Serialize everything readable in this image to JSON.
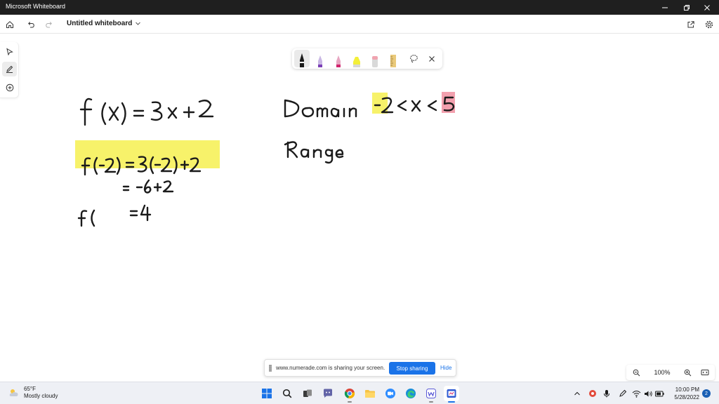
{
  "window": {
    "title": "Microsoft Whiteboard"
  },
  "toolbar": {
    "doc_title": "Untitled whiteboard"
  },
  "rail": {
    "items": [
      "select-tool",
      "pen-tool",
      "add-tool"
    ],
    "active": "pen-tool"
  },
  "palette": {
    "tools": [
      {
        "name": "black-pen",
        "color": "#1b1b1b"
      },
      {
        "name": "purple-pen",
        "color": "#7b3fb5"
      },
      {
        "name": "pink-pen",
        "color": "#d0246d"
      },
      {
        "name": "yellow-highlighter",
        "color": "#f3ef3a"
      },
      {
        "name": "eraser",
        "color": "#f0a4b0"
      },
      {
        "name": "ruler",
        "color": "#e9c97a"
      }
    ],
    "selected": "black-pen"
  },
  "sharing": {
    "message": "www.numerade.com is sharing your screen.",
    "stop_label": "Stop sharing",
    "hide_label": "Hide"
  },
  "zoom": {
    "level": "100%"
  },
  "taskbar": {
    "weather_temp": "65°F",
    "weather_desc": "Mostly cloudy",
    "time": "10:00 PM",
    "date": "5/28/2022",
    "notification_count": "2"
  },
  "colors": {
    "highlight_yellow": "#f7f26a",
    "highlight_pink": "#f2a0ae",
    "ink": "#1b1b1b",
    "accent": "#1a73e8"
  }
}
